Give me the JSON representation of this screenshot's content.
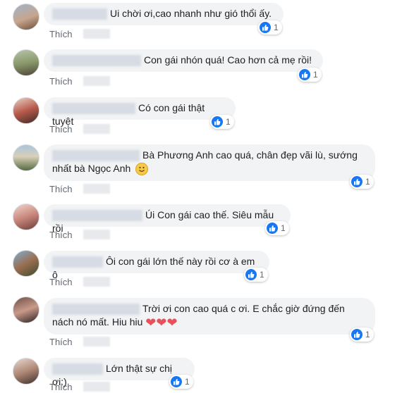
{
  "like_label": "Thích",
  "comments": [
    {
      "text": "Ui chời ơi,cao nhanh như gió thổi ấy.",
      "likes": "1"
    },
    {
      "text": "Con gái nhón quá! Cao hơn cả mẹ rồi!",
      "likes": "1"
    },
    {
      "text": "Có con gái thật tuyệt",
      "likes": "1"
    },
    {
      "text_line1": "Bà Phương Anh cao quá, chân đẹp vãi lù, sướng",
      "text_line2": "nhất bà Ngọc Anh",
      "emoji": "smile-emoji",
      "likes": "1"
    },
    {
      "text": "Úi Con gái cao thế. Siêu mẫu rồi",
      "likes": "1"
    },
    {
      "text": "Ôi con gái lớn thế này rồi cơ à em ô",
      "likes": "1"
    },
    {
      "text_line1": "Trời ơi con cao quá c ơi. E chắc giờ đứng đến",
      "text_line2": "nách nó mất. Hiu hiu",
      "emoji": "heart-emoji",
      "hearts": "❤❤❤",
      "likes": "1"
    },
    {
      "text": "Lớn thật sự chị ơi:)",
      "likes": "1"
    }
  ],
  "colors": {
    "like_blue": "#1877f2",
    "bubble_bg": "#f2f3f5",
    "meta_text": "#606770"
  }
}
